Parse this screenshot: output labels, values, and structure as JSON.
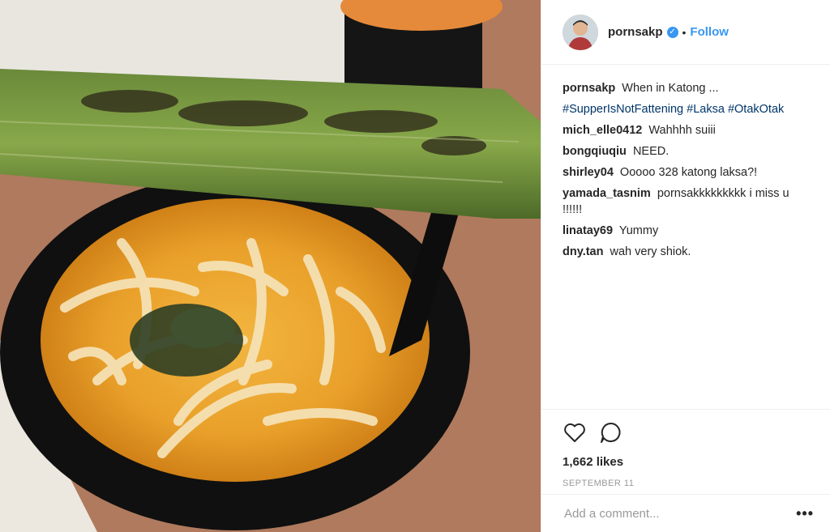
{
  "post": {
    "username": "pornsakp",
    "follow_label": "Follow",
    "dot": "•",
    "photo_alt": "Bowl of laksa with grilled otak-otak"
  },
  "caption": {
    "user": "pornsakp",
    "text": "When in Katong ...",
    "hashtags": [
      "#SupperIsNotFattening",
      "#Laksa",
      "#OtakOtak"
    ]
  },
  "comments": [
    {
      "user": "mich_elle0412",
      "text": "Wahhhh suiii"
    },
    {
      "user": "bongqiuqiu",
      "text": "NEED."
    },
    {
      "user": "shirley04",
      "text": "Ooooo 328 katong laksa?!"
    },
    {
      "user": "yamada_tasnim",
      "text": "pornsakkkkkkkkk i miss u !!!!!!"
    },
    {
      "user": "linatay69",
      "text": "Yummy"
    },
    {
      "user": "dny.tan",
      "text": "wah very shiok."
    }
  ],
  "stats": {
    "likes": "1,662 likes",
    "date": "SEPTEMBER 11"
  },
  "add_comment": {
    "placeholder": "Add a comment...",
    "more_label": "•••"
  },
  "icons": {
    "like": "heart-icon",
    "comment": "speech-bubble-icon",
    "verified": "verified-badge-icon",
    "more": "more-options-icon"
  },
  "colors": {
    "accent": "#3897f0",
    "hashtag": "#003569",
    "muted": "#999999"
  }
}
